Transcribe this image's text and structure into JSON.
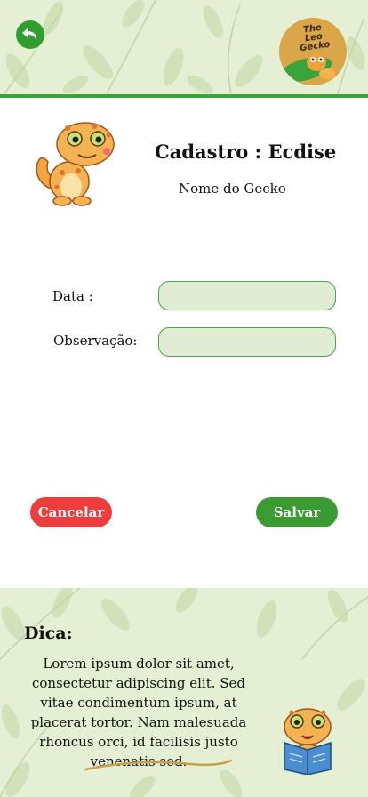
{
  "header": {
    "back_icon": "back-arrow-icon",
    "logo_text_line1": "The Leo",
    "logo_text_line2": "Gecko"
  },
  "form": {
    "title": "Cadastro : Ecdise",
    "gecko_name": "Nome do Gecko",
    "date_label": "Data :",
    "date_value": "",
    "notes_label": "Observação:",
    "notes_value": ""
  },
  "actions": {
    "cancel_label": "Cancelar",
    "save_label": "Salvar"
  },
  "tip": {
    "heading": "Dica:",
    "text": "Lorem ipsum dolor sit amet, consectetur adipiscing elit. Sed vitae condimentum ipsum, at placerat tortor. Nam malesuada rhoncus orci, id facilisis justo venenatis sed."
  },
  "colors": {
    "accent_green": "#3aa33a",
    "cancel_red": "#ee3d3d",
    "field_bg": "#e1ecd5",
    "pattern_bg": "#e4efd3"
  }
}
